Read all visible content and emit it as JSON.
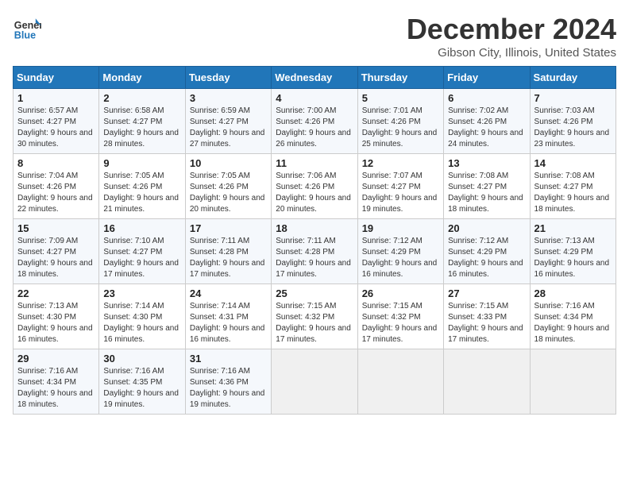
{
  "header": {
    "logo_line1": "General",
    "logo_line2": "Blue",
    "month": "December 2024",
    "location": "Gibson City, Illinois, United States"
  },
  "weekdays": [
    "Sunday",
    "Monday",
    "Tuesday",
    "Wednesday",
    "Thursday",
    "Friday",
    "Saturday"
  ],
  "weeks": [
    [
      {
        "day": "1",
        "sunrise": "Sunrise: 6:57 AM",
        "sunset": "Sunset: 4:27 PM",
        "daylight": "Daylight: 9 hours and 30 minutes."
      },
      {
        "day": "2",
        "sunrise": "Sunrise: 6:58 AM",
        "sunset": "Sunset: 4:27 PM",
        "daylight": "Daylight: 9 hours and 28 minutes."
      },
      {
        "day": "3",
        "sunrise": "Sunrise: 6:59 AM",
        "sunset": "Sunset: 4:27 PM",
        "daylight": "Daylight: 9 hours and 27 minutes."
      },
      {
        "day": "4",
        "sunrise": "Sunrise: 7:00 AM",
        "sunset": "Sunset: 4:26 PM",
        "daylight": "Daylight: 9 hours and 26 minutes."
      },
      {
        "day": "5",
        "sunrise": "Sunrise: 7:01 AM",
        "sunset": "Sunset: 4:26 PM",
        "daylight": "Daylight: 9 hours and 25 minutes."
      },
      {
        "day": "6",
        "sunrise": "Sunrise: 7:02 AM",
        "sunset": "Sunset: 4:26 PM",
        "daylight": "Daylight: 9 hours and 24 minutes."
      },
      {
        "day": "7",
        "sunrise": "Sunrise: 7:03 AM",
        "sunset": "Sunset: 4:26 PM",
        "daylight": "Daylight: 9 hours and 23 minutes."
      }
    ],
    [
      {
        "day": "8",
        "sunrise": "Sunrise: 7:04 AM",
        "sunset": "Sunset: 4:26 PM",
        "daylight": "Daylight: 9 hours and 22 minutes."
      },
      {
        "day": "9",
        "sunrise": "Sunrise: 7:05 AM",
        "sunset": "Sunset: 4:26 PM",
        "daylight": "Daylight: 9 hours and 21 minutes."
      },
      {
        "day": "10",
        "sunrise": "Sunrise: 7:05 AM",
        "sunset": "Sunset: 4:26 PM",
        "daylight": "Daylight: 9 hours and 20 minutes."
      },
      {
        "day": "11",
        "sunrise": "Sunrise: 7:06 AM",
        "sunset": "Sunset: 4:26 PM",
        "daylight": "Daylight: 9 hours and 20 minutes."
      },
      {
        "day": "12",
        "sunrise": "Sunrise: 7:07 AM",
        "sunset": "Sunset: 4:27 PM",
        "daylight": "Daylight: 9 hours and 19 minutes."
      },
      {
        "day": "13",
        "sunrise": "Sunrise: 7:08 AM",
        "sunset": "Sunset: 4:27 PM",
        "daylight": "Daylight: 9 hours and 18 minutes."
      },
      {
        "day": "14",
        "sunrise": "Sunrise: 7:08 AM",
        "sunset": "Sunset: 4:27 PM",
        "daylight": "Daylight: 9 hours and 18 minutes."
      }
    ],
    [
      {
        "day": "15",
        "sunrise": "Sunrise: 7:09 AM",
        "sunset": "Sunset: 4:27 PM",
        "daylight": "Daylight: 9 hours and 18 minutes."
      },
      {
        "day": "16",
        "sunrise": "Sunrise: 7:10 AM",
        "sunset": "Sunset: 4:27 PM",
        "daylight": "Daylight: 9 hours and 17 minutes."
      },
      {
        "day": "17",
        "sunrise": "Sunrise: 7:11 AM",
        "sunset": "Sunset: 4:28 PM",
        "daylight": "Daylight: 9 hours and 17 minutes."
      },
      {
        "day": "18",
        "sunrise": "Sunrise: 7:11 AM",
        "sunset": "Sunset: 4:28 PM",
        "daylight": "Daylight: 9 hours and 17 minutes."
      },
      {
        "day": "19",
        "sunrise": "Sunrise: 7:12 AM",
        "sunset": "Sunset: 4:29 PM",
        "daylight": "Daylight: 9 hours and 16 minutes."
      },
      {
        "day": "20",
        "sunrise": "Sunrise: 7:12 AM",
        "sunset": "Sunset: 4:29 PM",
        "daylight": "Daylight: 9 hours and 16 minutes."
      },
      {
        "day": "21",
        "sunrise": "Sunrise: 7:13 AM",
        "sunset": "Sunset: 4:29 PM",
        "daylight": "Daylight: 9 hours and 16 minutes."
      }
    ],
    [
      {
        "day": "22",
        "sunrise": "Sunrise: 7:13 AM",
        "sunset": "Sunset: 4:30 PM",
        "daylight": "Daylight: 9 hours and 16 minutes."
      },
      {
        "day": "23",
        "sunrise": "Sunrise: 7:14 AM",
        "sunset": "Sunset: 4:30 PM",
        "daylight": "Daylight: 9 hours and 16 minutes."
      },
      {
        "day": "24",
        "sunrise": "Sunrise: 7:14 AM",
        "sunset": "Sunset: 4:31 PM",
        "daylight": "Daylight: 9 hours and 16 minutes."
      },
      {
        "day": "25",
        "sunrise": "Sunrise: 7:15 AM",
        "sunset": "Sunset: 4:32 PM",
        "daylight": "Daylight: 9 hours and 17 minutes."
      },
      {
        "day": "26",
        "sunrise": "Sunrise: 7:15 AM",
        "sunset": "Sunset: 4:32 PM",
        "daylight": "Daylight: 9 hours and 17 minutes."
      },
      {
        "day": "27",
        "sunrise": "Sunrise: 7:15 AM",
        "sunset": "Sunset: 4:33 PM",
        "daylight": "Daylight: 9 hours and 17 minutes."
      },
      {
        "day": "28",
        "sunrise": "Sunrise: 7:16 AM",
        "sunset": "Sunset: 4:34 PM",
        "daylight": "Daylight: 9 hours and 18 minutes."
      }
    ],
    [
      {
        "day": "29",
        "sunrise": "Sunrise: 7:16 AM",
        "sunset": "Sunset: 4:34 PM",
        "daylight": "Daylight: 9 hours and 18 minutes."
      },
      {
        "day": "30",
        "sunrise": "Sunrise: 7:16 AM",
        "sunset": "Sunset: 4:35 PM",
        "daylight": "Daylight: 9 hours and 19 minutes."
      },
      {
        "day": "31",
        "sunrise": "Sunrise: 7:16 AM",
        "sunset": "Sunset: 4:36 PM",
        "daylight": "Daylight: 9 hours and 19 minutes."
      },
      null,
      null,
      null,
      null
    ]
  ]
}
